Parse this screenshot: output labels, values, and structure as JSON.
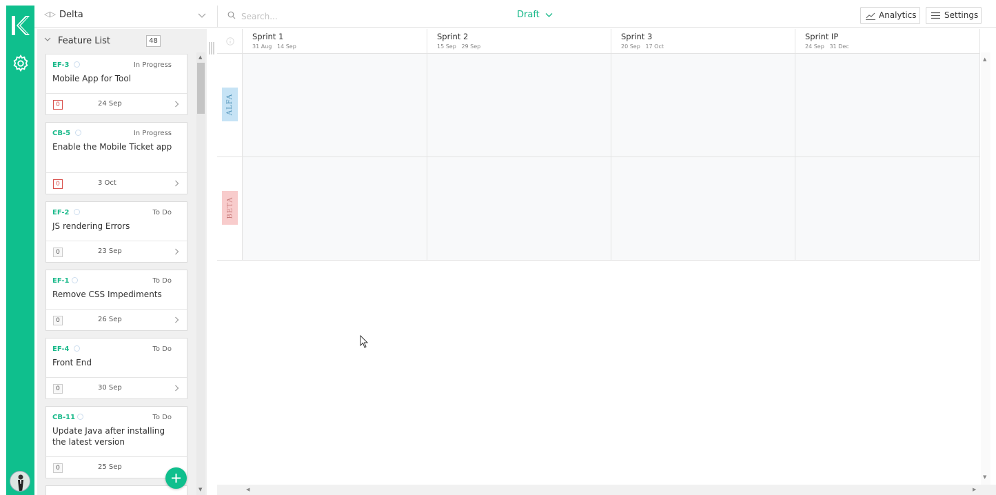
{
  "board": {
    "name": "Delta"
  },
  "search": {
    "placeholder": "Search..."
  },
  "mode": {
    "label": "Draft"
  },
  "toolbar": {
    "analytics_label": "Analytics",
    "settings_label": "Settings"
  },
  "feature_list": {
    "title": "Feature List",
    "count": "48",
    "cards": [
      {
        "key": "EF-3",
        "status": "In Progress",
        "title": "Mobile App for Tool",
        "count": "0",
        "date": "24 Sep"
      },
      {
        "key": "CB-5",
        "status": "In Progress",
        "title": "Enable the Mobile Ticket app",
        "count": "0",
        "date": "3 Oct"
      },
      {
        "key": "EF-2",
        "status": "To Do",
        "title": "JS rendering Errors",
        "count": "0",
        "date": "23 Sep"
      },
      {
        "key": "EF-1",
        "status": "To Do",
        "title": "Remove CSS Impediments",
        "count": "0",
        "date": "26 Sep"
      },
      {
        "key": "EF-4",
        "status": "To Do",
        "title": "Front End",
        "count": "0",
        "date": "30 Sep"
      },
      {
        "key": "CB-11",
        "status": "To Do",
        "title": "Update Java after installing the latest version",
        "count": "0",
        "date": "25 Sep"
      }
    ]
  },
  "sprints": [
    {
      "name": "Sprint 1",
      "start": "31 Aug",
      "end": "14 Sep"
    },
    {
      "name": "Sprint 2",
      "start": "15 Sep",
      "end": "29 Sep"
    },
    {
      "name": "Sprint 3",
      "start": "20 Sep",
      "end": "17 Oct"
    },
    {
      "name": "Sprint IP",
      "start": "24 Sep",
      "end": "31 Dec"
    }
  ],
  "teams": [
    {
      "name": "ALFA"
    },
    {
      "name": "BETA"
    }
  ],
  "colors": {
    "brand": "#0fbf8d",
    "accent_text": "#19b98a",
    "alert": "#d9534f"
  }
}
